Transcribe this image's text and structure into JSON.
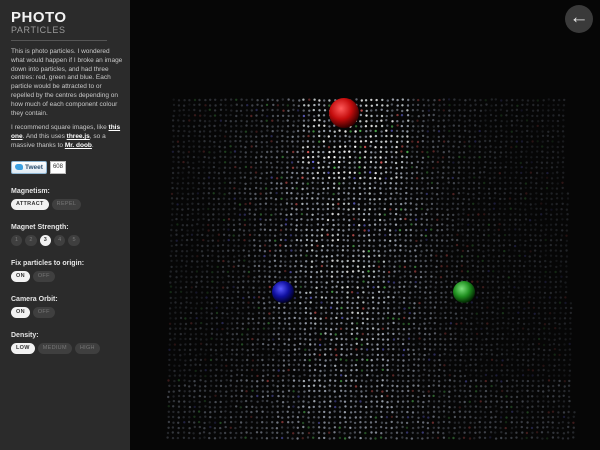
{
  "sidebar": {
    "title_main": "PHOTO",
    "title_sub": "PARTICLES",
    "intro": "This is photo particles. I wondered what would happen if I broke an image down into particles, and had three centres: red, green and blue. Each particle would be attracted to or repelled by the centres depending on how much of each component colour they contain.",
    "recommend_pre": "I recommend square images, like ",
    "recommend_link": "this one",
    "recommend_mid": ". And this uses ",
    "threejs_link": "three.js",
    "recommend_mid2": ", so a massive thanks to ",
    "mrdoob_link": "Mr. doob",
    "recommend_end": ".",
    "tweet_label": "Tweet",
    "tweet_count": "608"
  },
  "controls": {
    "magnetism": {
      "label": "Magnetism:",
      "options": [
        "ATTRACT",
        "REPEL"
      ],
      "selected": "ATTRACT"
    },
    "strength": {
      "label": "Magnet Strength:",
      "options": [
        "1",
        "2",
        "3",
        "4",
        "5"
      ],
      "selected": "3"
    },
    "fix": {
      "label": "Fix particles to origin:",
      "options": [
        "ON",
        "OFF"
      ],
      "selected": "ON"
    },
    "orbit": {
      "label": "Camera Orbit:",
      "options": [
        "ON",
        "OFF"
      ],
      "selected": "ON"
    },
    "density": {
      "label": "Density:",
      "options": [
        "LOW",
        "MEDIUM",
        "HIGH"
      ],
      "selected": "LOW"
    }
  },
  "stage": {
    "back_icon": "←",
    "colors": {
      "red_centre": "#cc1010",
      "green_centre": "#2a9a2a",
      "blue_centre": "#1a1a9a"
    }
  }
}
